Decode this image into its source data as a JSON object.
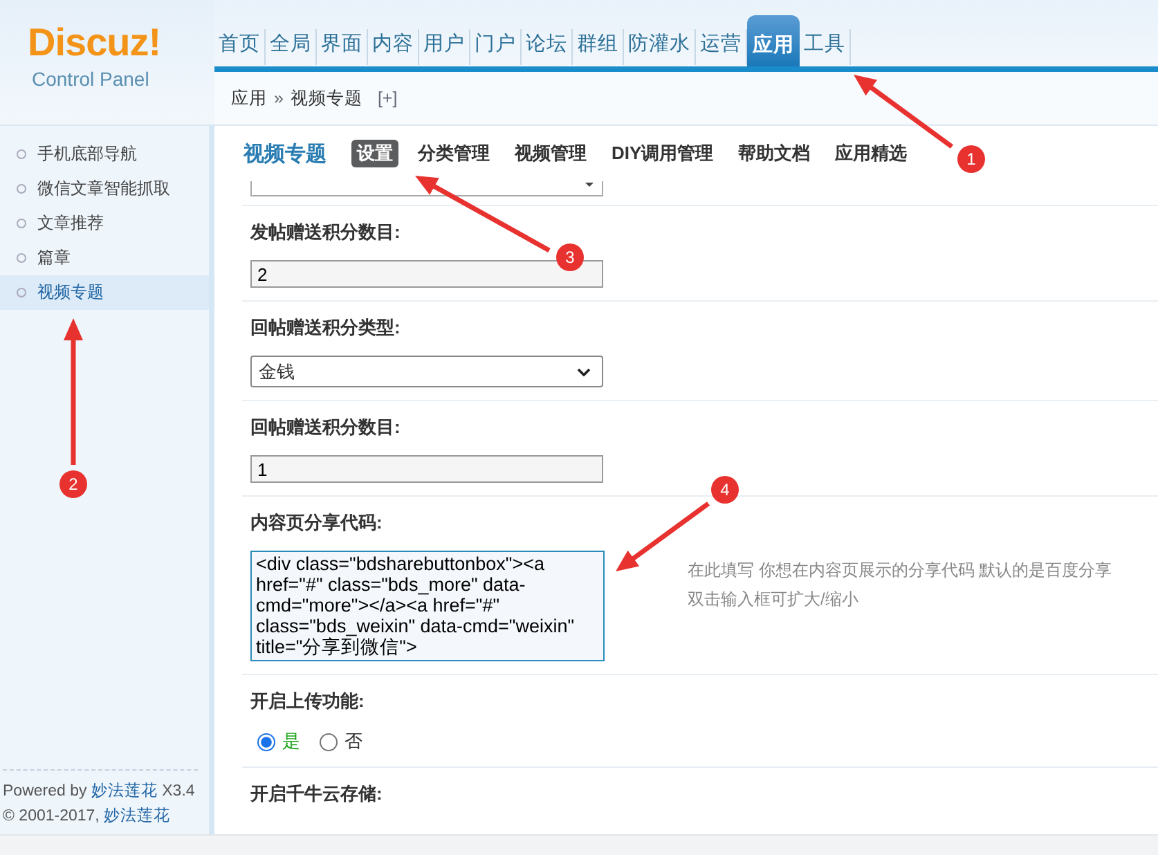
{
  "logo": {
    "title": "Discuz!",
    "subtitle": "Control Panel"
  },
  "nav": [
    {
      "label": "首页",
      "selected": false
    },
    {
      "label": "全局",
      "selected": false
    },
    {
      "label": "界面",
      "selected": false
    },
    {
      "label": "内容",
      "selected": false
    },
    {
      "label": "用户",
      "selected": false
    },
    {
      "label": "门户",
      "selected": false
    },
    {
      "label": "论坛",
      "selected": false
    },
    {
      "label": "群组",
      "selected": false
    },
    {
      "label": "防灌水",
      "selected": false
    },
    {
      "label": "运营",
      "selected": false
    },
    {
      "label": "应用",
      "selected": true
    },
    {
      "label": "工具",
      "selected": false
    }
  ],
  "breadcrumb": {
    "items": [
      "应用",
      "视频专题"
    ],
    "separator": "»",
    "add": "[+]"
  },
  "sidebar": {
    "items": [
      {
        "label": "手机底部导航",
        "selected": false
      },
      {
        "label": "微信文章智能抓取",
        "selected": false
      },
      {
        "label": "文章推荐",
        "selected": false
      },
      {
        "label": "篇章",
        "selected": false
      },
      {
        "label": "视频专题",
        "selected": true
      }
    ],
    "footer": {
      "powered_prefix": "Powered by",
      "powered_link": "妙法莲花",
      "version": "X3.4",
      "copyright_prefix": "© 2001-2017,",
      "copyright_link": "妙法莲花"
    }
  },
  "page": {
    "title": "视频专题",
    "tabs": [
      {
        "label": "设置",
        "selected": true
      },
      {
        "label": "分类管理",
        "selected": false
      },
      {
        "label": "视频管理",
        "selected": false
      },
      {
        "label": "DIY调用管理",
        "selected": false
      },
      {
        "label": "帮助文档",
        "selected": false
      },
      {
        "label": "应用精选",
        "selected": false
      }
    ]
  },
  "settings": [
    {
      "kind": "cut_select"
    },
    {
      "kind": "text",
      "label": "发帖赠送积分数目:",
      "value": "2"
    },
    {
      "kind": "select",
      "label": "回帖赠送积分类型:",
      "value": "金钱"
    },
    {
      "kind": "text",
      "label": "回帖赠送积分数目:",
      "value": "1"
    },
    {
      "kind": "textarea",
      "label": "内容页分享代码:",
      "value": "<div class=\"bdsharebuttonbox\"><a href=\"#\" class=\"bds_more\" data-cmd=\"more\"></a><a href=\"#\" class=\"bds_weixin\" data-cmd=\"weixin\" title=\"分享到微信\">",
      "hint": [
        "在此填写 你想在内容页展示的分享代码 默认的是百度分享",
        "双击输入框可扩大/缩小"
      ]
    },
    {
      "kind": "radio",
      "label": "开启上传功能:",
      "options": [
        {
          "label": "是",
          "selected": true
        },
        {
          "label": "否",
          "selected": false
        }
      ]
    },
    {
      "kind": "label",
      "label": "开启千牛云存储:"
    }
  ],
  "annotations": [
    "1",
    "2",
    "3",
    "4"
  ]
}
